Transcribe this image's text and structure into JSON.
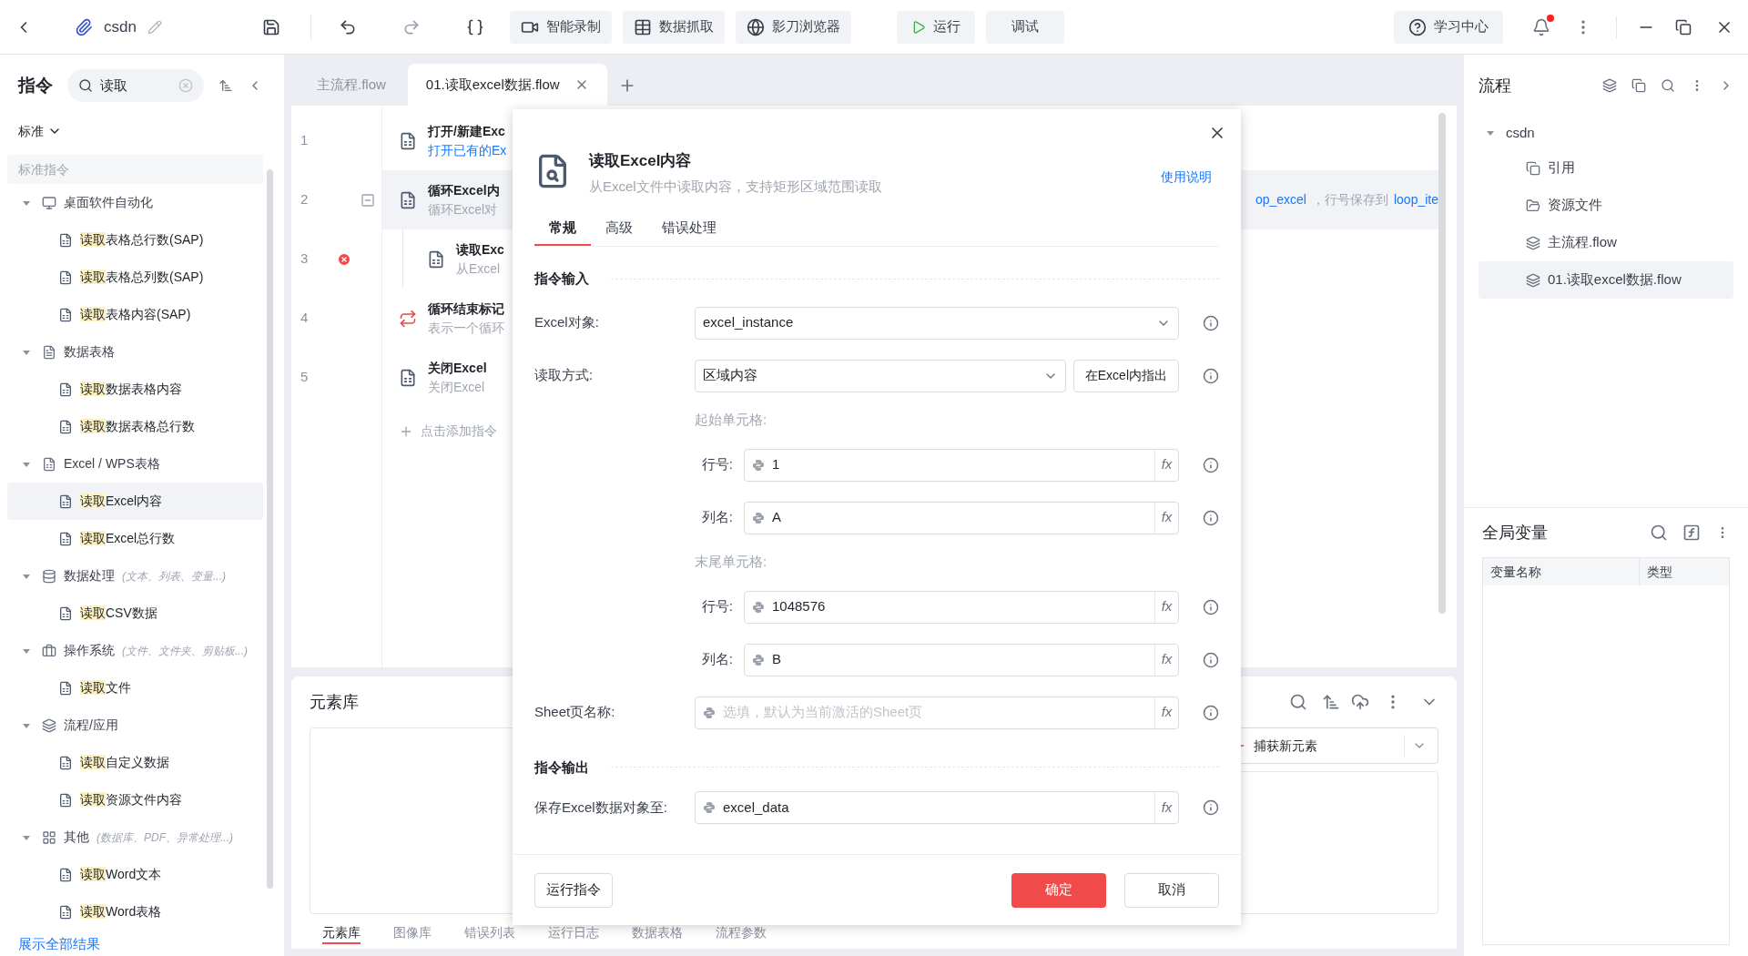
{
  "topbar": {
    "project": "csdn",
    "buttons": [
      {
        "kind": "record",
        "label": "智能录制"
      },
      {
        "kind": "grab",
        "label": "数据抓取"
      },
      {
        "kind": "browser",
        "label": "影刀浏览器"
      }
    ],
    "run": "运行",
    "debug": "调试",
    "learn": "学习中心",
    "notification": true
  },
  "sidebar": {
    "title": "指令",
    "search": {
      "value": "读取"
    },
    "filter": "标准",
    "section": "标准指令",
    "show_all": "展示全部结果",
    "groups": [
      {
        "kind": "monitor",
        "label": "桌面软件自动化",
        "expanded": true,
        "children": [
          {
            "match": "读取",
            "rest": "表格总行数(SAP)",
            "selected": false
          },
          {
            "match": "读取",
            "rest": "表格总列数(SAP)",
            "selected": false
          },
          {
            "match": "读取",
            "rest": "表格内容(SAP)",
            "selected": false
          }
        ]
      },
      {
        "kind": "doc",
        "label": "数据表格",
        "expanded": true,
        "children": [
          {
            "match": "读取",
            "rest": "数据表格内容",
            "selected": false
          },
          {
            "match": "读取",
            "rest": "数据表格总行数",
            "selected": false
          }
        ]
      },
      {
        "kind": "sheet",
        "label": "Excel / WPS表格",
        "expanded": true,
        "children": [
          {
            "match": "读取",
            "rest": "Excel内容",
            "selected": true
          },
          {
            "match": "读取",
            "rest": "Excel总行数",
            "selected": false
          }
        ]
      },
      {
        "kind": "data",
        "label": "数据处理",
        "hint": "(文本、列表、变量...)",
        "expanded": true,
        "children": [
          {
            "match": "读取",
            "rest": "CSV数据",
            "selected": false
          }
        ]
      },
      {
        "kind": "system",
        "label": "操作系统",
        "hint": "(文件、文件夹、剪贴板...)",
        "expanded": true,
        "children": [
          {
            "match": "读取",
            "rest": "文件",
            "selected": false
          }
        ]
      },
      {
        "kind": "layers",
        "label": "流程/应用",
        "expanded": true,
        "children": [
          {
            "match": "读取",
            "rest": "自定义数据",
            "selected": false
          },
          {
            "match": "读取",
            "rest": "资源文件内容",
            "selected": false
          }
        ]
      },
      {
        "kind": "grid",
        "label": "其他",
        "hint": "(数据库、PDF、异常处理...)",
        "expanded": true,
        "children": [
          {
            "match": "读取",
            "rest": "Word文本",
            "selected": false
          },
          {
            "match": "读取",
            "rest": "Word表格",
            "selected": false
          }
        ]
      }
    ]
  },
  "editor_tabs": [
    {
      "label": "主流程.flow",
      "selected": false
    },
    {
      "label": "01.读取excel数据.flow",
      "selected": true
    }
  ],
  "flow": {
    "lines": [
      {
        "number": "1",
        "title": "打开/新建Exc",
        "desc": "打开已有的Ex",
        "desc_link": true,
        "nested": false,
        "selected": false
      },
      {
        "number": "2",
        "title": "循环Excel内",
        "desc": "循环Excel对",
        "desc_link": false,
        "collapsible": true,
        "nested": false,
        "selected": true,
        "tail": [
          "op_excel",
          "，行号保存到",
          "loop_ite"
        ]
      },
      {
        "number": "3",
        "title": "读取Exc",
        "desc": "从Excel",
        "desc_link": false,
        "error": true,
        "nested": true,
        "selected": false
      },
      {
        "number": "4",
        "title": "循环结束标记",
        "desc": "表示一个循环",
        "desc_link": false,
        "nested": false,
        "selected": false
      },
      {
        "number": "5",
        "title": "关闭Excel",
        "desc": "关闭Excel",
        "desc_link": false,
        "nested": false,
        "selected": false
      }
    ],
    "add": "点击添加指令"
  },
  "element_panel": {
    "title": "元素库",
    "capture": "捕获新元素",
    "tabs": [
      {
        "label": "元素库",
        "selected": true
      },
      {
        "label": "图像库",
        "selected": false
      },
      {
        "label": "错误列表",
        "selected": false
      },
      {
        "label": "运行日志",
        "selected": false
      },
      {
        "label": "数据表格",
        "selected": false
      },
      {
        "label": "流程参数",
        "selected": false
      }
    ]
  },
  "dialog": {
    "title": "读取Excel内容",
    "subtitle": "从Excel文件中读取内容，支持矩形区域范围读取",
    "help": "使用说明",
    "tabs": [
      {
        "label": "常规",
        "selected": true
      },
      {
        "label": "高级",
        "selected": false
      },
      {
        "label": "错误处理",
        "selected": false
      }
    ],
    "input_section": "指令输入",
    "fields": [
      {
        "kind": "select",
        "label": "Excel对象:",
        "value": "excel_instance"
      },
      {
        "kind": "select_button",
        "label": "读取方式:",
        "value": "区域内容",
        "button": "在Excel内指出"
      },
      {
        "kind": "subheading",
        "label": "起始单元格:"
      },
      {
        "kind": "sub_expr",
        "label": "行号:",
        "value": "1",
        "fx": "fx"
      },
      {
        "kind": "sub_expr",
        "label": "列名:",
        "value": "A",
        "fx": "fx"
      },
      {
        "kind": "subheading",
        "label": "末尾单元格:"
      },
      {
        "kind": "sub_expr",
        "label": "行号:",
        "value": "1048576",
        "fx": "fx"
      },
      {
        "kind": "sub_expr",
        "label": "列名:",
        "value": "B",
        "fx": "fx"
      },
      {
        "kind": "expr",
        "label": "Sheet页名称:",
        "placeholder": "选填，默认为当前激活的Sheet页",
        "fx": "fx"
      }
    ],
    "output_section": "指令输出",
    "outputs": [
      {
        "kind": "var",
        "label": "保存Excel数据对象至:",
        "value": "excel_data",
        "fx": "fx"
      }
    ],
    "run": "运行指令",
    "ok": "确定",
    "cancel": "取消"
  },
  "flows_panel": {
    "title": "流程",
    "root": {
      "label": "csdn",
      "expanded": true,
      "children": [
        {
          "kind": "ref",
          "label": "引用",
          "selected": false
        },
        {
          "kind": "folder",
          "label": "资源文件",
          "selected": false
        },
        {
          "kind": "flow",
          "label": "主流程.flow",
          "selected": false
        },
        {
          "kind": "flow",
          "label": "01.读取excel数据.flow",
          "selected": true
        }
      ]
    }
  },
  "globals": {
    "title": "全局变量",
    "columns": [
      "变量名称",
      "类型"
    ]
  }
}
